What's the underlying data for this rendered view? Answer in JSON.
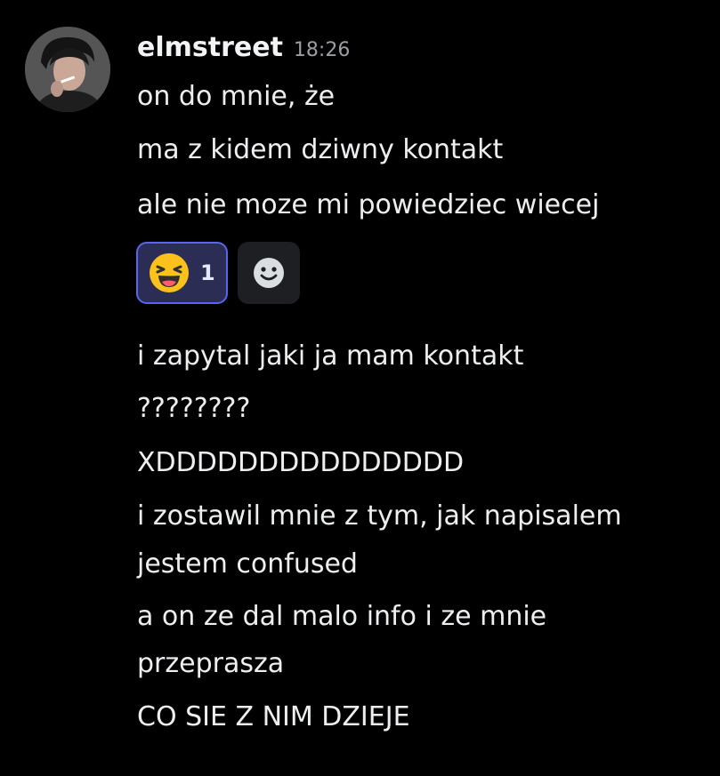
{
  "message": {
    "author": "elmstreet",
    "timestamp": "18:26",
    "lines_before_reaction": [
      "on do mnie, że",
      "ma z kidem dziwny kontakt",
      "ale nie moze mi powiedziec wiecej"
    ],
    "reactions": [
      {
        "emoji": "laughing-face",
        "count": "1",
        "reacted_by_me": true
      }
    ],
    "add_reaction_icon": "smiley-face-icon",
    "lines_after_reaction": [
      "i zapytal jaki ja mam kontakt",
      "????????",
      "XDDDDDDDDDDDDDDD",
      "i zostawil mnie z tym, jak napisalem",
      "jestem confused",
      "a on ze dal malo info i ze mnie",
      "przeprasza",
      "CO SIE Z NIM DZIEJE"
    ]
  },
  "colors": {
    "background": "#000000",
    "active_reaction_border": "#5865f2",
    "active_reaction_fill": "#2b2d55",
    "timestamp": "#9b9ea4"
  }
}
